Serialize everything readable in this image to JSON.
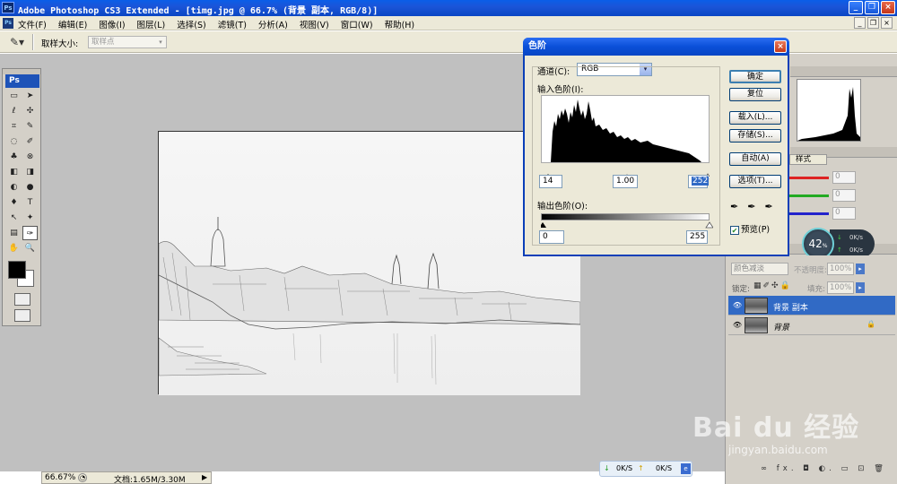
{
  "window": {
    "title": "Adobe Photoshop CS3 Extended - [timg.jpg @ 66.7% (背景 副本, RGB/8)]",
    "app_icon": "Ps",
    "controls": [
      "_",
      "❐",
      "×"
    ]
  },
  "menu": {
    "items": [
      "文件(F)",
      "编辑(E)",
      "图像(I)",
      "图层(L)",
      "选择(S)",
      "滤镜(T)",
      "分析(A)",
      "视图(V)",
      "窗口(W)",
      "帮助(H)"
    ],
    "right_controls": [
      "_",
      "❐",
      "×"
    ]
  },
  "options_bar": {
    "sample_size_label": "取样大小:",
    "sample_size_value": "取样点"
  },
  "toolbox": {
    "badge": "Ps",
    "tools": [
      "▭",
      "➤",
      "ℓ",
      "✣",
      "⌗",
      "✎",
      "◌",
      "✐",
      "♣",
      "⊗",
      "◧",
      "◨",
      "◐",
      "●",
      "♦",
      "T",
      "↖",
      "✦",
      "▤",
      "✑",
      "✋",
      "🔍"
    ]
  },
  "status": {
    "zoom": "66.67%",
    "doc_info": "文档:1.65M/3.30M"
  },
  "net_widget": {
    "down": "0K/S",
    "up": "0K/S",
    "icon": "e"
  },
  "speed_widget": {
    "percent": "42",
    "percent_unit": "%",
    "rate1": "0K/s",
    "rate2": "0K/s"
  },
  "panels": {
    "color_tab": "样式",
    "color_values": [
      "0",
      "0",
      "0"
    ]
  },
  "layers": {
    "blend_mode": "颜色减淡",
    "opacity_label": "不透明度:",
    "opacity_value": "100%",
    "lock_label": "锁定:",
    "fill_label": "填充:",
    "fill_value": "100%",
    "items": [
      {
        "name": "背景 副本",
        "selected": true
      },
      {
        "name": "背景",
        "selected": false,
        "locked": true
      }
    ],
    "footer_icons": [
      "∞",
      "fx.",
      "◘",
      "◐.",
      "▭",
      "⊡",
      "🗑"
    ]
  },
  "levels_dialog": {
    "title": "色阶",
    "channel_label": "通道(C):",
    "channel_value": "RGB",
    "input_label": "输入色阶(I):",
    "input_black": "14",
    "input_gamma": "1.00",
    "input_white": "252",
    "output_label": "输出色阶(O):",
    "output_black": "0",
    "output_white": "255",
    "buttons": {
      "ok": "确定",
      "reset": "复位",
      "load": "载入(L)...",
      "save": "存储(S)...",
      "auto": "自动(A)",
      "options": "选项(T)..."
    },
    "preview_label": "预览(P)",
    "preview_checked": true
  },
  "watermark": {
    "brand": "Bai du 经验",
    "url": "jingyan.baidu.com"
  }
}
